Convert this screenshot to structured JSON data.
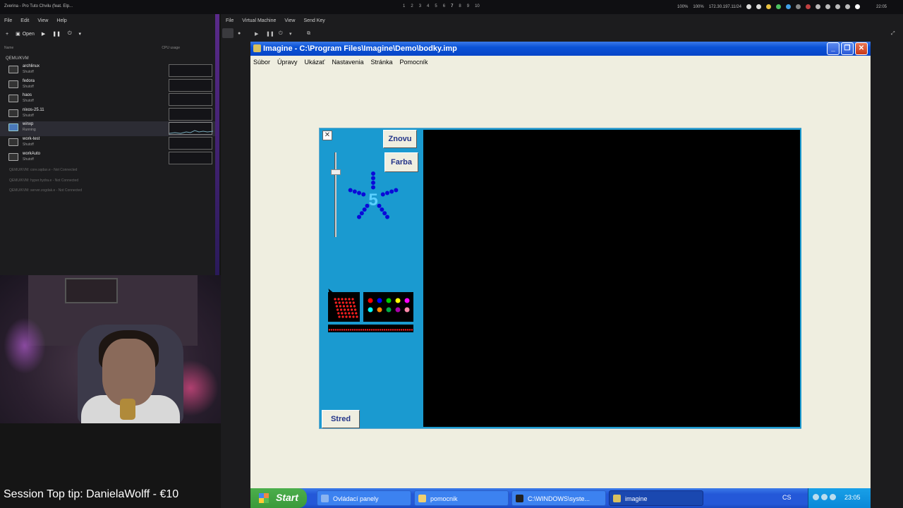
{
  "system_bar": {
    "now_playing": "Zverina - Pro Tuto Chvilu (feat. Elp...",
    "workspaces": [
      "1",
      "2",
      "3",
      "4",
      "5",
      "6",
      "7",
      "8",
      "9",
      "10"
    ],
    "active_workspace": "7",
    "battery": "100%",
    "volume": "100%",
    "ip": "172.30.197.11/24",
    "time": "22:05"
  },
  "virt_manager": {
    "menu": [
      "File",
      "Edit",
      "View",
      "Help"
    ],
    "toolbar_open": "Open",
    "col_name": "Name",
    "col_cpu": "CPU usage",
    "group": "QEMU/KVM",
    "vms": [
      {
        "name": "archlinux",
        "state": "Shutoff"
      },
      {
        "name": "fedora",
        "state": "Shutoff"
      },
      {
        "name": "haos",
        "state": "Shutoff"
      },
      {
        "name": "nixos-25.11",
        "state": "Shutoff"
      },
      {
        "name": "winxp",
        "state": "Running"
      },
      {
        "name": "work-test",
        "state": "Shutoff"
      },
      {
        "name": "workAuto",
        "state": "Shutoff"
      }
    ],
    "connections": [
      "QEMU/KVM: core.sqdax.e - Not Connected",
      "QEMU/KVM: hyper.hydra.e - Not Connected",
      "QEMU/KVM: server.zogdak.e - Not Connected"
    ]
  },
  "stream": {
    "tip_text": "Session Top tip: DanielaWolff - €10"
  },
  "viewer": {
    "menu": [
      "File",
      "Virtual Machine",
      "View",
      "Send Key"
    ]
  },
  "xp_window": {
    "title": "Imagine - C:\\Program Files\\Imagine\\Demo\\bodky.imp",
    "menu": [
      "Súbor",
      "Úpravy",
      "Ukázať",
      "Nastavenia",
      "Stránka",
      "Pomocník"
    ]
  },
  "imagine": {
    "btn_znovu": "Znovu",
    "btn_farba": "Farba",
    "btn_stred": "Stred",
    "star_number": "5",
    "star_color": "#0a0ad8",
    "palette_colors": [
      "#ff0000",
      "#0000ff",
      "#00cc00",
      "#ffff00",
      "#ff00ff",
      "#00ffff",
      "#ff8800",
      "#00aa44",
      "#aa00aa",
      "#ff88aa"
    ]
  },
  "taskbar": {
    "start": "Start",
    "tasks": [
      {
        "label": "Ovládací panely"
      },
      {
        "label": "pomocnik"
      },
      {
        "label": "C:\\WINDOWS\\syste..."
      },
      {
        "label": "imagine"
      }
    ],
    "lang": "CS",
    "clock": "23:05"
  }
}
